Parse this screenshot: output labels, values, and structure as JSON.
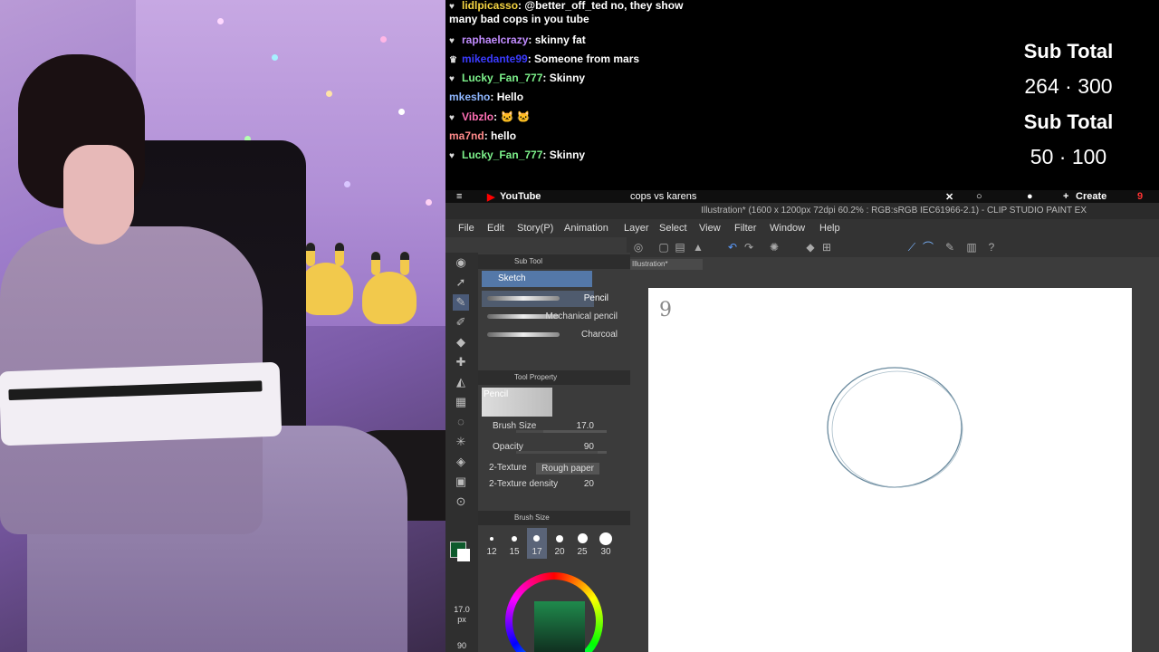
{
  "chat": {
    "messages": [
      {
        "badge": "♥",
        "user": "lidlpicasso",
        "text": ": @better_off_ted no, they show",
        "user_color": "#f5d442"
      },
      {
        "badge": "",
        "user": "",
        "text": "many bad cops in you tube",
        "user_color": "#ffffff"
      },
      {
        "badge": "♥",
        "user": "raphaelcrazy",
        "text": ": skinny fat",
        "user_color": "#c18cff"
      },
      {
        "badge": "♛",
        "user": "mikedante99",
        "text": ": Someone from mars",
        "user_color": "#3b3bff"
      },
      {
        "badge": "♥",
        "user": "Lucky_Fan_777",
        "text": ": Skinny",
        "user_color": "#7cf08a"
      },
      {
        "badge": "",
        "user": "mkesho",
        "text": ": Hello",
        "user_color": "#8fb7ff"
      },
      {
        "badge": "♥",
        "user": "Vibzlo",
        "text": ": 🐱 🐱",
        "user_color": "#ff6fb4"
      },
      {
        "badge": "",
        "user": "ma7nd",
        "text": ": hello",
        "user_color": "#ff8a8a"
      },
      {
        "badge": "♥",
        "user": "Lucky_Fan_777",
        "text": ": Skinny",
        "user_color": "#7cf08a"
      }
    ]
  },
  "subs": {
    "label1": "Sub Total",
    "value1": "264 · 300",
    "label2": "Sub Total",
    "value2": "50 · 100"
  },
  "youtube": {
    "logo_text": "YouTube",
    "search_text": "cops vs karens",
    "create_label": "Create",
    "notif_count": "9"
  },
  "csp": {
    "title": "Illustration* (1600 x 1200px 72dpi 60.2% : RGB:sRGB IEC61966-2.1) - CLIP STUDIO PAINT EX",
    "menu": [
      "File",
      "Edit",
      "Story(P)",
      "Animation",
      "Layer",
      "Select",
      "View",
      "Filter",
      "Window",
      "Help"
    ],
    "doc_tab": "Illustration*",
    "sub_tool_header": "Sub Tool",
    "sub_tool_group": "Sketch",
    "brushes": [
      "Pencil",
      "Mechanical pencil",
      "Charcoal"
    ],
    "tool_property_header": "Tool Property",
    "tool_property_name": "Pencil",
    "props": {
      "brush_size_label": "Brush Size",
      "brush_size_value": "17.0",
      "opacity_label": "Opacity",
      "opacity_value": "90",
      "texture_label": "2-Texture",
      "texture_value": "Rough paper",
      "texture_density_label": "2-Texture density",
      "texture_density_value": "20"
    },
    "brush_size_header": "Brush Size",
    "brush_sizes": [
      "12",
      "15",
      "17",
      "20",
      "25",
      "30"
    ],
    "selected_size_index": 2,
    "size_readout": "17.0",
    "size_unit": "px",
    "opacity_readout": "90",
    "main_color": "#0e5a2c",
    "canvas_glyph": "9"
  }
}
